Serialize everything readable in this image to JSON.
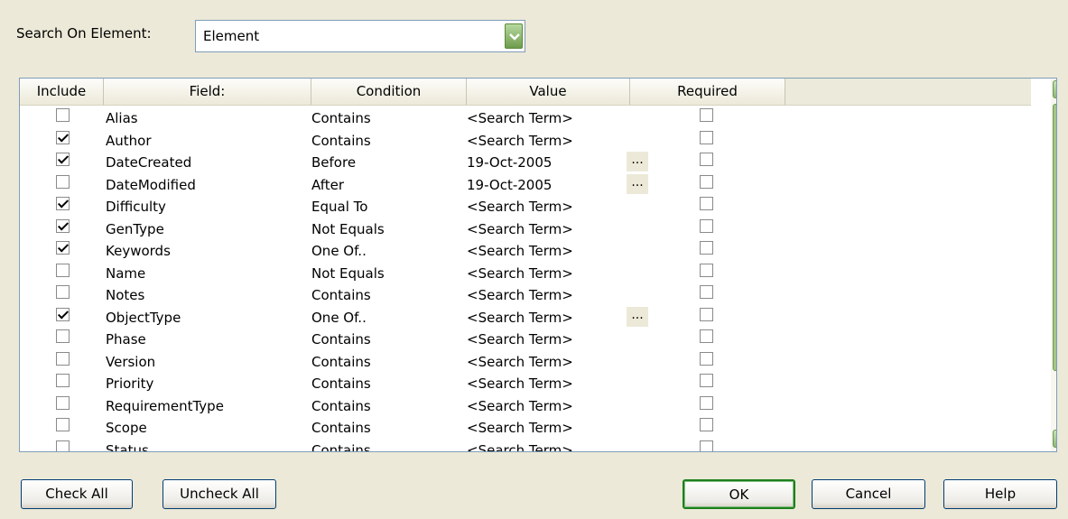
{
  "search_on": {
    "label": "Search On Element:",
    "value": "Element"
  },
  "columns": [
    "Include",
    "Field:",
    "Condition",
    "Value",
    "Required"
  ],
  "rows": [
    {
      "include": false,
      "field": "Alias",
      "condition": "Contains",
      "value": "<Search Term>",
      "ellipsis": "",
      "required": false
    },
    {
      "include": true,
      "field": "Author",
      "condition": "Contains",
      "value": "<Search Term>",
      "ellipsis": "",
      "required": false
    },
    {
      "include": true,
      "field": "DateCreated",
      "condition": "Before",
      "value": "19-Oct-2005",
      "ellipsis": "...",
      "required": false
    },
    {
      "include": false,
      "field": "DateModified",
      "condition": "After",
      "value": "19-Oct-2005",
      "ellipsis": "...",
      "required": false
    },
    {
      "include": true,
      "field": "Difficulty",
      "condition": "Equal To",
      "value": "<Search Term>",
      "ellipsis": "",
      "required": false
    },
    {
      "include": true,
      "field": "GenType",
      "condition": "Not Equals",
      "value": "<Search Term>",
      "ellipsis": "",
      "required": false
    },
    {
      "include": true,
      "field": "Keywords",
      "condition": "One Of..",
      "value": "<Search Term>",
      "ellipsis": "",
      "required": false
    },
    {
      "include": false,
      "field": "Name",
      "condition": "Not Equals",
      "value": "<Search Term>",
      "ellipsis": "",
      "required": false
    },
    {
      "include": false,
      "field": "Notes",
      "condition": "Contains",
      "value": "<Search Term>",
      "ellipsis": "",
      "required": false
    },
    {
      "include": true,
      "field": "ObjectType",
      "condition": "One Of..",
      "value": "<Search Term>",
      "ellipsis": "...",
      "required": false
    },
    {
      "include": false,
      "field": "Phase",
      "condition": "Contains",
      "value": "<Search Term>",
      "ellipsis": "",
      "required": false
    },
    {
      "include": false,
      "field": "Version",
      "condition": "Contains",
      "value": "<Search Term>",
      "ellipsis": "",
      "required": false
    },
    {
      "include": false,
      "field": "Priority",
      "condition": "Contains",
      "value": "<Search Term>",
      "ellipsis": "",
      "required": false
    },
    {
      "include": false,
      "field": "RequirementType",
      "condition": "Contains",
      "value": "<Search Term>",
      "ellipsis": "",
      "required": false
    },
    {
      "include": false,
      "field": "Scope",
      "condition": "Contains",
      "value": "<Search Term>",
      "ellipsis": "",
      "required": false
    },
    {
      "include": false,
      "field": "Status",
      "condition": "Contains",
      "value": "<Search Term>",
      "ellipsis": "",
      "required": false
    }
  ],
  "buttons": {
    "check_all": "Check All",
    "uncheck_all": "Uncheck All",
    "ok": "OK",
    "cancel": "Cancel",
    "help": "Help"
  },
  "icons": {
    "dropdown": "chevron-down-icon",
    "scroll_up": "chevron-up-icon",
    "scroll_down": "chevron-down-icon"
  },
  "colors": {
    "dialog_bg": "#ECE9D8",
    "scroll_green": "#8BB16C",
    "default_button_border": "#1E7F1E"
  }
}
